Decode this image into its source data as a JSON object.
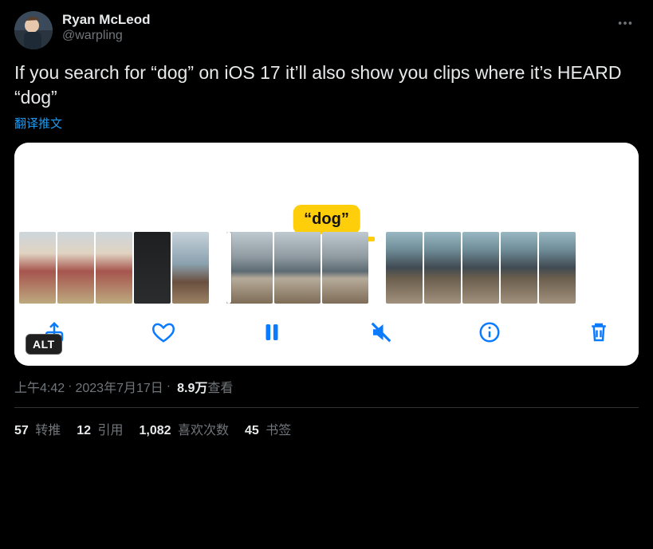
{
  "author": {
    "display_name": "Ryan McLeod",
    "handle": "@warpling"
  },
  "body": "If you search for “dog” on iOS 17 it’ll also show you clips where it’s HEARD “dog”",
  "translate_label": "翻译推文",
  "media": {
    "search_label": "“dog”",
    "alt_badge": "ALT"
  },
  "meta": {
    "time": "上午4:42",
    "date": "2023年7月17日",
    "views_count": "8.9万",
    "views_label": " 查看"
  },
  "stats": {
    "retweets_count": "57",
    "retweets_label": " 转推",
    "quotes_count": "12",
    "quotes_label": " 引用",
    "likes_count": "1,082",
    "likes_label": " 喜欢次数",
    "bookmarks_count": "45",
    "bookmarks_label": " 书签"
  }
}
